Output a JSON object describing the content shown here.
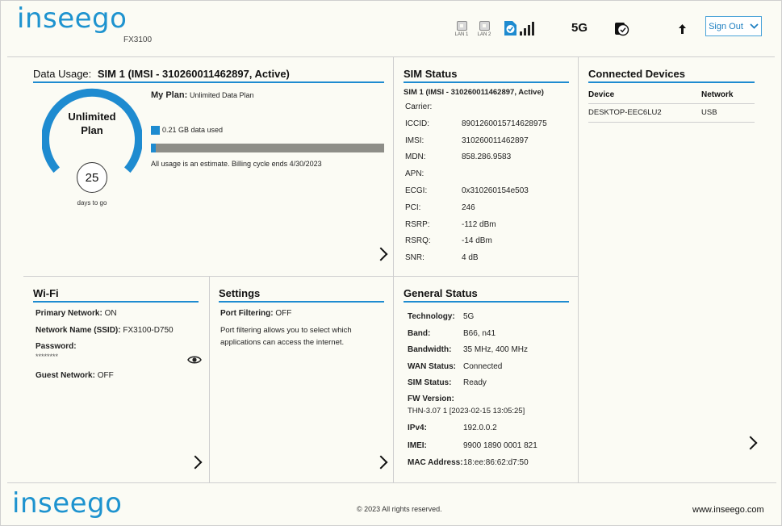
{
  "header": {
    "logo": "inseego",
    "model": "FX3100",
    "lan1_label": "LAN 1",
    "lan2_label": "LAN 2",
    "network_type": "5G",
    "sign_out_label": "Sign Out"
  },
  "data_usage": {
    "title_prefix": "Data Usage:",
    "title": "SIM 1 (IMSI - 310260011462897, Active)",
    "gauge_line1": "Unlimited",
    "gauge_line2": "Plan",
    "days": "25",
    "days_label": "days to go",
    "plan_label": "My Plan:",
    "plan_value": "Unlimited Data Plan",
    "used_text": "0.21 GB data used",
    "usage_fraction": 0.02,
    "note": "All usage is an estimate. Billing cycle ends 4/30/2023"
  },
  "sim_status": {
    "title": "SIM Status",
    "subtitle": "SIM 1 (IMSI - 310260011462897, Active)",
    "rows": [
      {
        "label": "Carrier:",
        "value": ""
      },
      {
        "label": "ICCID:",
        "value": "8901260015714628975"
      },
      {
        "label": "IMSI:",
        "value": "310260011462897"
      },
      {
        "label": "MDN:",
        "value": "858.286.9583"
      },
      {
        "label": "APN:",
        "value": ""
      },
      {
        "label": "ECGI:",
        "value": "0x310260154e503"
      },
      {
        "label": "PCI:",
        "value": "246"
      },
      {
        "label": "RSRP:",
        "value": "-112 dBm"
      },
      {
        "label": "RSRQ:",
        "value": "-14 dBm"
      },
      {
        "label": "SNR:",
        "value": "4 dB"
      }
    ]
  },
  "connected_devices": {
    "title": "Connected Devices",
    "col_device": "Device",
    "col_network": "Network",
    "rows": [
      {
        "device": "DESKTOP-EEC6LU2",
        "network": "USB"
      }
    ]
  },
  "wifi": {
    "title": "Wi-Fi",
    "primary_label": "Primary Network:",
    "primary_value": "ON",
    "ssid_label": "Network Name (SSID):",
    "ssid_value": "FX3100-D750",
    "password_label": "Password:",
    "password_value": "********",
    "guest_label": "Guest Network:",
    "guest_value": "OFF"
  },
  "settings": {
    "title": "Settings",
    "port_label": "Port Filtering:",
    "port_value": "OFF",
    "desc_line1": "Port filtering allows you to select which",
    "desc_line2": "applications can access the internet."
  },
  "general_status": {
    "title": "General Status",
    "rows": [
      {
        "label": "Technology:",
        "value": "5G"
      },
      {
        "label": "Band:",
        "value": "B66, n41"
      },
      {
        "label": "Bandwidth:",
        "value": "35 MHz, 400 MHz"
      },
      {
        "label": "WAN Status:",
        "value": "Connected"
      },
      {
        "label": "SIM Status:",
        "value": "Ready"
      }
    ],
    "fw_label": "FW Version:",
    "fw_value": "THN-3.07 1 [2023-02-15 13:05:25]",
    "rows2": [
      {
        "label": "IPv4:",
        "value": "192.0.0.2"
      },
      {
        "label": "IMEI:",
        "value": "9900 1890 0001 821"
      },
      {
        "label": "MAC Address:",
        "value": "18:ee:86:62:d7:50"
      }
    ]
  },
  "footer": {
    "logo": "inseego",
    "copyright": "© 2023 All rights reserved.",
    "website": "www.inseego.com"
  },
  "colors": {
    "accent": "#1e8bd0",
    "background": "#fbfbf4",
    "usage_bar": "#8e8e88"
  }
}
